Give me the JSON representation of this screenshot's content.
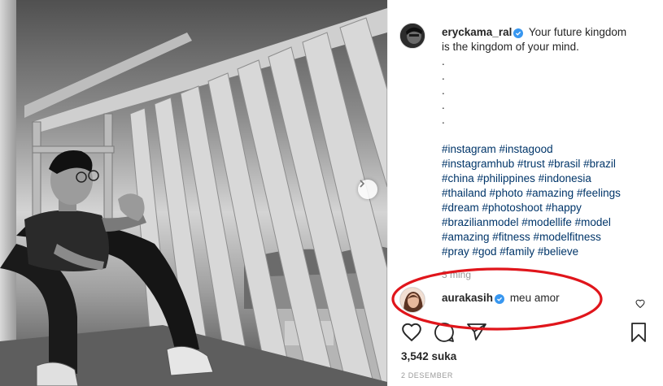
{
  "post": {
    "photo_alt": "Black and white photo of a man sitting on a balcony",
    "carousel_next_icon": "chevron-right-icon"
  },
  "caption": {
    "username": "eryckama_ral",
    "text_line1": "Your future kingdom",
    "text_line2": "is the kingdom of your mind.",
    "dots": [
      ".",
      ".",
      ".",
      ".",
      "."
    ],
    "hashtag_lines": [
      "#instagram #instagood",
      "#instagramhub #trust #brasil #brazil",
      "#china #philippines #indonesia",
      "#thailand #photo #amazing #feelings",
      "#dream #photoshoot #happy",
      "#brazilianmodel #modellife #model",
      "#amazing #fitness #modelfitness",
      "#pray #god #family #believe"
    ]
  },
  "meta": {
    "time_ago": "3 ming",
    "likes": "3,542 suka",
    "date": "2 DESEMBER"
  },
  "comment": {
    "username": "aurakasih",
    "text": "meu amor"
  },
  "colors": {
    "verified": "#3897f0",
    "hashtag": "#003569",
    "annotation": "#e0151b",
    "muted": "#999999"
  },
  "icons": {
    "like": "heart-icon",
    "comment": "comment-icon",
    "share": "share-icon",
    "save": "bookmark-icon",
    "comment_like": "heart-icon"
  }
}
